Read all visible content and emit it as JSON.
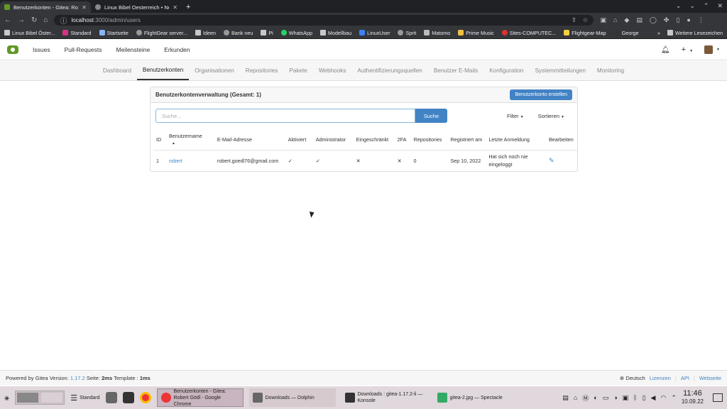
{
  "browser": {
    "tabs": [
      {
        "title": "Benutzerkonten - Gitea: Robert",
        "active": true
      },
      {
        "title": "Linux Bibel Oesterreich • Neu",
        "active": false
      }
    ],
    "new_tab": "+",
    "url_host": "localhost",
    "url_path": ":3000/admin/users",
    "bookmarks": [
      "Linux Bibel Öster...",
      "Standard",
      "Startseite",
      "FlightGear server...",
      "Ideen",
      "Bank neu",
      "Pi",
      "WhatsApp",
      "Modellbau",
      "LinuxUser",
      "Sprit",
      "Matomo",
      "Prime Music",
      "Sites-COMPUTEC...",
      "Flightgear-Map",
      "George"
    ],
    "bookmarks_more": "»",
    "other_bookmarks": "Weitere Lesezeichen"
  },
  "gitea": {
    "nav": [
      "Issues",
      "Pull-Requests",
      "Meilensteine",
      "Erkunden"
    ],
    "admin_tabs": [
      "Dashboard",
      "Benutzerkonten",
      "Organisationen",
      "Repositories",
      "Pakete",
      "Webhooks",
      "Authentifizierungsquellen",
      "Benutzer E-Mails",
      "Konfiguration",
      "Systemmitteilungen",
      "Monitoring"
    ],
    "active_admin_tab": "Benutzerkonten",
    "panel_title": "Benutzerkontenverwaltung (Gesamt: 1)",
    "create_button": "Benutzerkonto erstellen",
    "search_placeholder": "Suche...",
    "search_button": "Suche",
    "filter_label": "Filter",
    "sort_label": "Sortieren",
    "table": {
      "headers": [
        "ID",
        "Benutzername",
        "E-Mail-Adresse",
        "Aktiviert",
        "Administrator",
        "Eingeschränkt",
        "2FA",
        "Repositories",
        "Registriert am",
        "Letzte Anmeldung",
        "Bearbeiten"
      ],
      "rows": [
        {
          "id": "1",
          "username": "robert",
          "email": "robert.goedl76@gmail.com",
          "activated": "✓",
          "admin": "✓",
          "restricted": "✕",
          "twofa": "✕",
          "repos": "0",
          "registered": "Sep 10, 2022",
          "last_login": "Hat sich noch nie eingeloggt"
        }
      ]
    },
    "footer": {
      "powered": "Powered by Gitea Version:",
      "version": "1.17.2",
      "page_label": "Seite:",
      "page_time": "2ms",
      "template_label": "Template :",
      "template_time": "1ms",
      "language": "Deutsch",
      "links": [
        "Lizenzen",
        "API",
        "Webseite"
      ]
    }
  },
  "taskbar": {
    "standard_label": "Standard",
    "tasks": [
      {
        "title": "Benutzerkonten - Gitea: Robert Gödl - Google Chrome",
        "active": true
      },
      {
        "title": "Downloads — Dolphin",
        "active": false
      },
      {
        "title": "Downloads : gitea-1.17.2-li — Konsole",
        "active": false
      },
      {
        "title": "gitea-2.jpg — Spectacle",
        "active": false
      }
    ],
    "time": "11:46",
    "date": "10.09.22"
  }
}
